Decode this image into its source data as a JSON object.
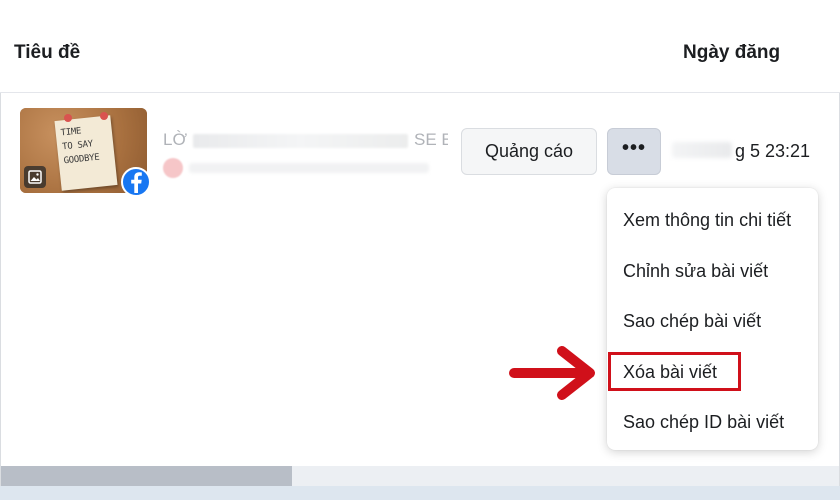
{
  "table": {
    "columns": {
      "title": "Tiêu đề",
      "date": "Ngày đăng"
    },
    "rows": [
      {
        "thumbnail_note_lines": [
          "TIME",
          "TO SAY",
          "GOODBYE"
        ],
        "title_start": "LỜ",
        "title_end": "SE E...",
        "date_visible": "g 5 23:21",
        "ads_button": "Quảng cáo",
        "more_button": "•••"
      }
    ]
  },
  "menu": {
    "items": [
      "Xem thông tin chi tiết",
      "Chỉnh sửa bài viết",
      "Sao chép bài viết",
      "Xóa bài viết",
      "Sao chép ID bài viết"
    ],
    "highlighted_index": 3
  },
  "icons": {
    "image_badge": "image-icon",
    "platform_badge": "facebook-icon",
    "annotation": "red-arrow-icon"
  },
  "colors": {
    "facebook_blue": "#1877f2",
    "highlight_red": "#d0101a",
    "more_button_bg": "#d8dde6"
  }
}
